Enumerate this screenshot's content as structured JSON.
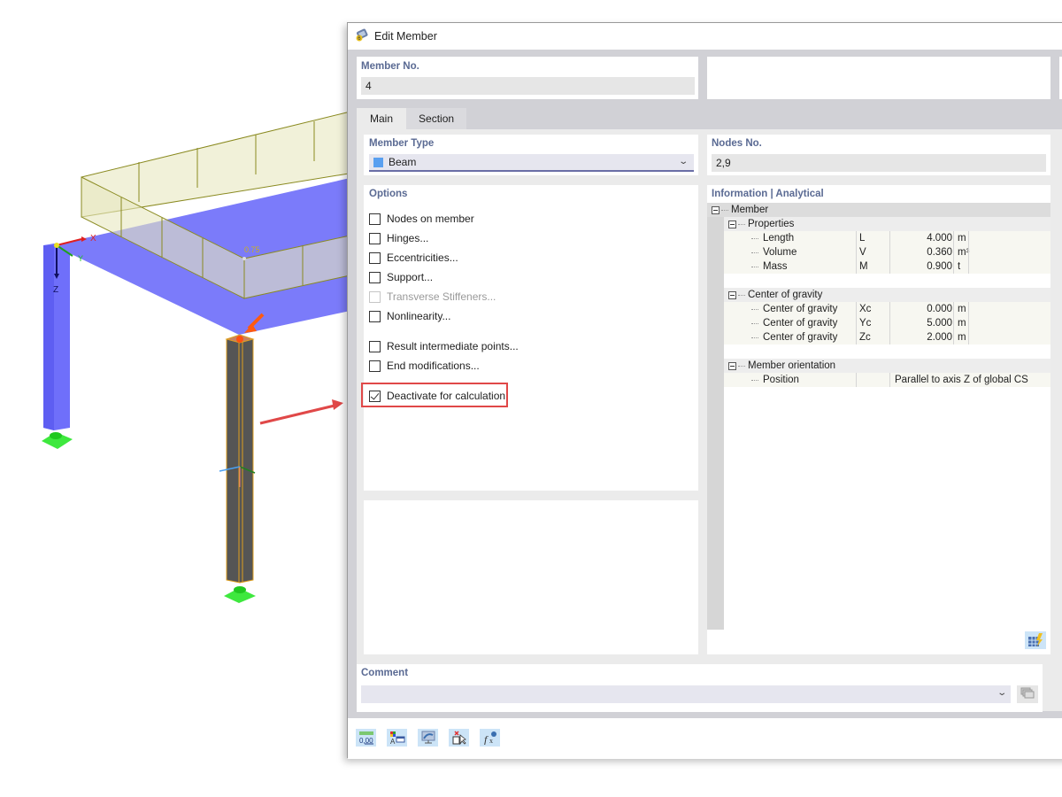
{
  "viewport": {
    "load_label": "0.75",
    "axes": {
      "x": "X",
      "y": "Y",
      "z": "Z"
    }
  },
  "dialog": {
    "title": "Edit Member",
    "title_icon": "member-icon",
    "member_no": {
      "label": "Member No.",
      "value": "4"
    },
    "tabs": [
      {
        "label": "Main",
        "active": true
      },
      {
        "label": "Section",
        "active": false
      }
    ],
    "member_type": {
      "label": "Member Type",
      "value": "Beam",
      "swatch_color": "#5aa0f0"
    },
    "nodes_no": {
      "label": "Nodes No.",
      "value": "2,9"
    },
    "options": {
      "label": "Options",
      "items": [
        {
          "label": "Nodes on member",
          "checked": false,
          "enabled": true
        },
        {
          "label": "Hinges...",
          "checked": false,
          "enabled": true
        },
        {
          "label": "Eccentricities...",
          "checked": false,
          "enabled": true
        },
        {
          "label": "Support...",
          "checked": false,
          "enabled": true
        },
        {
          "label": "Transverse Stiffeners...",
          "checked": false,
          "enabled": false
        },
        {
          "label": "Nonlinearity...",
          "checked": false,
          "enabled": true
        },
        {
          "label": "Result intermediate points...",
          "checked": false,
          "enabled": true
        },
        {
          "label": "End modifications...",
          "checked": false,
          "enabled": true
        },
        {
          "label": "Deactivate for calculation",
          "checked": true,
          "enabled": true
        }
      ]
    },
    "information": {
      "label": "Information | Analytical",
      "root": "Member",
      "groups": [
        {
          "name": "Properties",
          "rows": [
            {
              "name": "Length",
              "symbol": "L",
              "value": "4.000",
              "unit": "m"
            },
            {
              "name": "Volume",
              "symbol": "V",
              "value": "0.360",
              "unit": "m³"
            },
            {
              "name": "Mass",
              "symbol": "M",
              "value": "0.900",
              "unit": "t"
            }
          ]
        },
        {
          "name": "Center of gravity",
          "rows": [
            {
              "name": "Center of gravity",
              "symbol": "Xc",
              "value": "0.000",
              "unit": "m"
            },
            {
              "name": "Center of gravity",
              "symbol": "Yc",
              "value": "5.000",
              "unit": "m"
            },
            {
              "name": "Center of gravity",
              "symbol": "Zc",
              "value": "2.000",
              "unit": "m"
            }
          ]
        },
        {
          "name": "Member orientation",
          "rows": [
            {
              "name": "Position",
              "symbol": "",
              "text": "Parallel to axis Z of global CS"
            }
          ]
        }
      ]
    },
    "comment": {
      "label": "Comment",
      "value": ""
    },
    "footer_buttons": [
      {
        "name": "units-decimals-button",
        "icon": "units-icon"
      },
      {
        "name": "display-properties-button",
        "icon": "color-text-icon"
      },
      {
        "name": "view-button",
        "icon": "monitor-icon"
      },
      {
        "name": "select-object-button",
        "icon": "pointer-icon"
      },
      {
        "name": "formula-button",
        "icon": "formula-icon"
      }
    ]
  }
}
